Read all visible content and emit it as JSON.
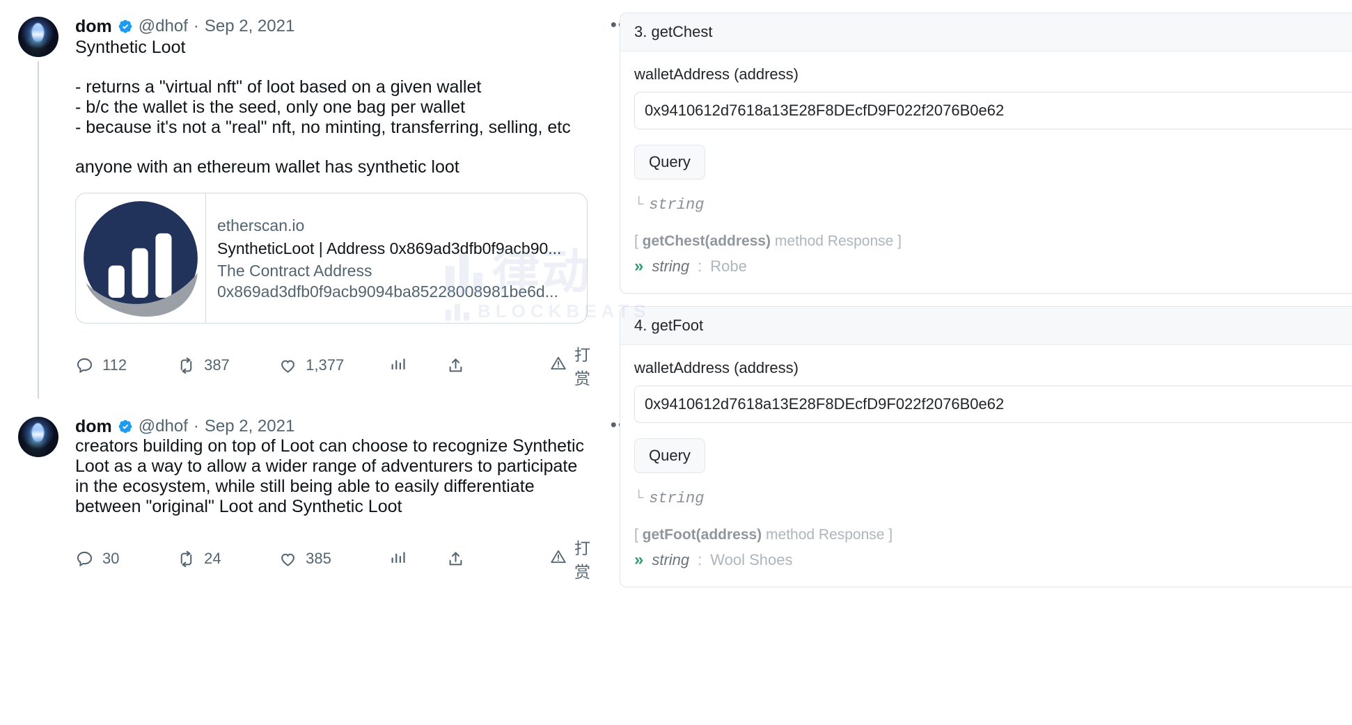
{
  "thread": {
    "tweets": [
      {
        "author": {
          "display_name": "dom",
          "verified_icon": "verified-badge-icon",
          "handle": "@dhof",
          "separator": "·",
          "date": "Sep 2, 2021",
          "avatar_alt": "dom-avatar"
        },
        "more_label": "•••",
        "text_block_1": "Synthetic Loot",
        "text_block_2": "- returns a \"virtual nft\" of loot based on a given wallet\n- b/c the wallet is the seed, only one bag per wallet\n- because it's not a \"real\" nft, no minting, transferring, selling, etc",
        "text_block_3": "anyone with an ethereum wallet has synthetic loot",
        "card": {
          "thumb_alt": "etherscan-logo",
          "domain": "etherscan.io",
          "title": "SyntheticLoot | Address 0x869ad3dfb0f9acb90...",
          "desc_line_1": "The Contract Address",
          "desc_line_2": "0x869ad3dfb0f9acb9094ba85228008981be6d..."
        },
        "actions": {
          "reply_icon": "reply-icon",
          "reply_count": "112",
          "retweet_icon": "retweet-icon",
          "retweet_count": "387",
          "like_icon": "like-icon",
          "like_count": "1,377",
          "views_icon": "views-bar-chart-icon",
          "views_count": "",
          "share_icon": "share-upload-icon",
          "tip_icon": "tip-warning-icon",
          "tip_label": "打赏"
        }
      },
      {
        "author": {
          "display_name": "dom",
          "verified_icon": "verified-badge-icon",
          "handle": "@dhof",
          "separator": "·",
          "date": "Sep 2, 2021",
          "avatar_alt": "dom-avatar"
        },
        "more_label": "•••",
        "text_block_1": "creators building on top of Loot can choose to recognize Synthetic Loot as a way to allow a wider range of adventurers to participate in the ecosystem, while still being able to easily differentiate between \"original\" Loot and Synthetic Loot",
        "actions": {
          "reply_icon": "reply-icon",
          "reply_count": "30",
          "retweet_icon": "retweet-icon",
          "retweet_count": "24",
          "like_icon": "like-icon",
          "like_count": "385",
          "views_icon": "views-bar-chart-icon",
          "views_count": "",
          "share_icon": "share-upload-icon",
          "tip_icon": "tip-warning-icon",
          "tip_label": "打赏"
        }
      }
    ]
  },
  "contract_panel": {
    "methods": [
      {
        "header": "3. getChest",
        "param_label": "walletAddress (address)",
        "param_value": "0x9410612d7618a13E28F8DEcfD9F022f2076B0e62",
        "param_placeholder": "walletAddress (address)",
        "query_button": "Query",
        "return_type": "string",
        "return_corner": "└",
        "response_header_open": "[ ",
        "response_header_method": "getChest(address)",
        "response_header_rest": " method Response ]",
        "response_chevron": "»",
        "response_type": "string",
        "response_colon": ":",
        "response_value": "Robe"
      },
      {
        "header": "4. getFoot",
        "param_label": "walletAddress (address)",
        "param_value": "0x9410612d7618a13E28F8DEcfD9F022f2076B0e62",
        "param_placeholder": "walletAddress (address)",
        "query_button": "Query",
        "return_type": "string",
        "return_corner": "└",
        "response_header_open": "[ ",
        "response_header_method": "getFoot(address)",
        "response_header_rest": " method Response ]",
        "response_chevron": "»",
        "response_type": "string",
        "response_colon": ":",
        "response_value": "Wool Shoes"
      }
    ]
  },
  "watermark": {
    "main_text": "律动",
    "sub_text": "BLOCKBEATS"
  },
  "colors": {
    "verified_blue": "#1d9bf0",
    "text_primary": "#0f1419",
    "text_secondary": "#536471",
    "border": "#cfd9de",
    "etherscan_navy": "#21325b",
    "response_green": "#2f9e6e",
    "panel_header_bg": "#f7f8fa"
  }
}
